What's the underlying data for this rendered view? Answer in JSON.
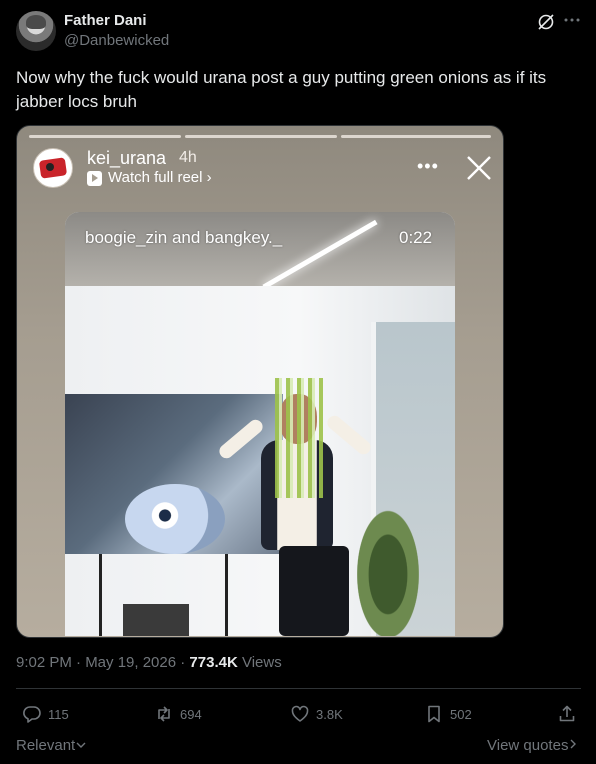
{
  "author": {
    "display_name": "Father Dani",
    "handle": "@Danbewicked"
  },
  "tweet": {
    "text": "Now why the fuck would urana post a guy putting green onions as if its jabber locs bruh"
  },
  "story": {
    "username": "kei_urana",
    "time": "4h",
    "watch_label": "Watch full reel ›",
    "more_symbol": "•••"
  },
  "video": {
    "caption": "boogie_zin and bangkey._",
    "duration": "0:22"
  },
  "meta": {
    "timestamp": "9:02 PM · May 19, 2026 · ",
    "views_count": "773.4K",
    "views_label": " Views"
  },
  "actions": {
    "replies": "115",
    "reposts": "694",
    "likes": "3.8K",
    "bookmarks": "502"
  },
  "footer": {
    "relevant": "Relevant",
    "view_quotes": "View quotes"
  },
  "colors": {
    "background": "#000000",
    "text": "#e7e9ea",
    "muted": "#71767b",
    "divider": "#2f3336"
  }
}
